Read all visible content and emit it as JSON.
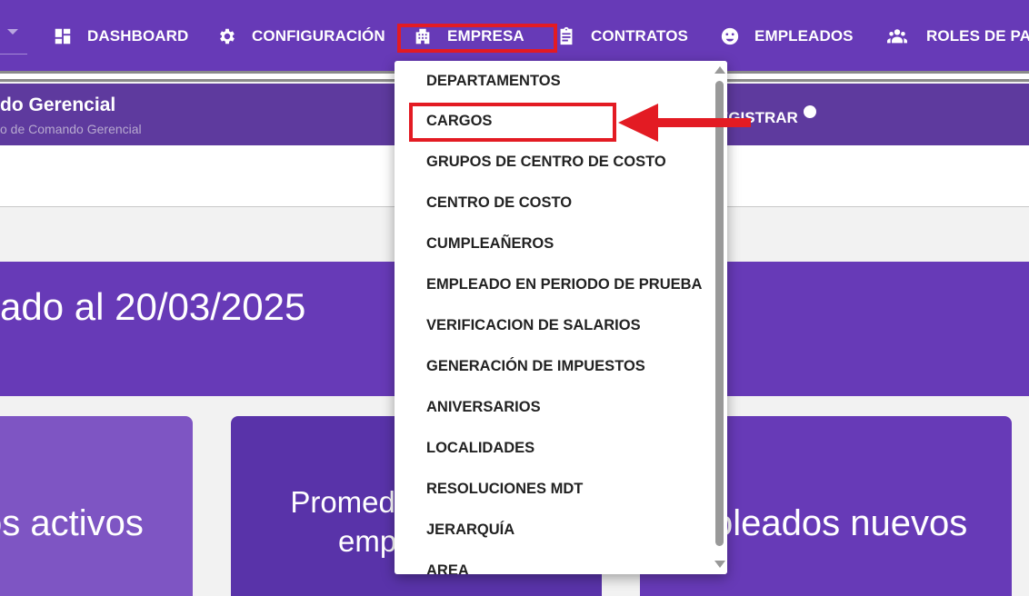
{
  "colors": {
    "primary": "#673ab7",
    "annotation_red": "#e31b23"
  },
  "nav": {
    "items": [
      {
        "label": "DASHBOARD",
        "icon": "dashboard-icon"
      },
      {
        "label": "CONFIGURACIÓN",
        "icon": "gear-icon"
      },
      {
        "label": "EMPRESA",
        "icon": "building-icon"
      },
      {
        "label": "CONTRATOS",
        "icon": "clipboard-icon"
      },
      {
        "label": "EMPLEADOS",
        "icon": "face-icon"
      },
      {
        "label": "ROLES DE PAG",
        "icon": "group-icon"
      }
    ]
  },
  "header": {
    "title": "do Gerencial",
    "subtitle": "o de Comando Gerencial",
    "register_label": "EGISTRAR"
  },
  "banner": {
    "text": "ado al 20/03/2025"
  },
  "cards": [
    {
      "text": "os activos"
    },
    {
      "line1": "Promed",
      "line2": "emp"
    },
    {
      "text": "oleados nuevos"
    }
  ],
  "dropdown": {
    "items": [
      "DEPARTAMENTOS",
      "CARGOS",
      "GRUPOS DE CENTRO DE COSTO",
      "CENTRO DE COSTO",
      "CUMPLEAÑEROS",
      "EMPLEADO EN PERIODO DE PRUEBA",
      "VERIFICACION DE SALARIOS",
      "GENERACIÓN DE IMPUESTOS",
      "ANIVERSARIOS",
      "LOCALIDADES",
      "RESOLUCIONES MDT",
      "JERARQUÍA",
      "AREA"
    ]
  }
}
